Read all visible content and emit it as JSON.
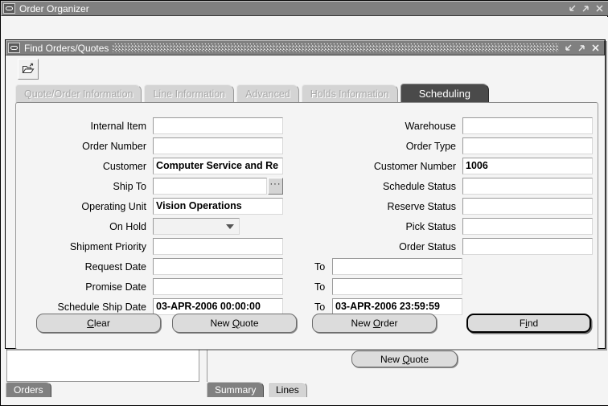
{
  "organizer": {
    "title": "Order Organizer",
    "titlebar_icon": "oracle-window-icon",
    "minimize_icon": "minimize-icon",
    "maximize_icon": "maximize-icon",
    "close_icon": "close-icon"
  },
  "background": {
    "orders_tab": "Orders",
    "summary_tab": "Summary",
    "lines_tab": "Lines",
    "new_quote_label": "New Quote"
  },
  "find_window": {
    "title": "Find  Orders/Quotes",
    "titlebar_icon": "oracle-window-icon",
    "hatch": "window-move-handle",
    "toolbar": {
      "open_folder_label": "open-folder-icon"
    },
    "tabs": [
      {
        "label": "Quote/Order Information",
        "state": "disabled"
      },
      {
        "label": "Line Information",
        "state": "disabled"
      },
      {
        "label": "Advanced",
        "state": "disabled"
      },
      {
        "label": "Holds Information",
        "state": "disabled"
      },
      {
        "label": "Scheduling",
        "state": "active"
      }
    ],
    "left_fields": [
      {
        "label": "Internal Item",
        "value": "",
        "type": "text"
      },
      {
        "label": "Order Number",
        "value": "",
        "type": "text"
      },
      {
        "label": "Customer",
        "value": "Computer Service and Re",
        "type": "text"
      },
      {
        "label": "Ship To",
        "value": "",
        "type": "lov",
        "lov_label": "···"
      },
      {
        "label": "Operating Unit",
        "value": "Vision Operations",
        "type": "text"
      },
      {
        "label": "On Hold",
        "value": "",
        "type": "combo"
      },
      {
        "label": "Shipment Priority",
        "value": "",
        "type": "text"
      },
      {
        "label": "Request Date",
        "value": "",
        "type": "text",
        "to_label": "To",
        "to_value": ""
      },
      {
        "label": "Promise Date",
        "value": "",
        "type": "text",
        "to_label": "To",
        "to_value": ""
      },
      {
        "label": "Schedule Ship Date",
        "value": "03-APR-2006 00:00:00",
        "type": "text",
        "to_label": "To",
        "to_value": "03-APR-2006 23:59:59"
      }
    ],
    "right_fields": [
      {
        "label": "Warehouse",
        "value": ""
      },
      {
        "label": "Order Type",
        "value": ""
      },
      {
        "label": "Customer Number",
        "value": "1006"
      },
      {
        "label": "Schedule Status",
        "value": ""
      },
      {
        "label": "Reserve Status",
        "value": ""
      },
      {
        "label": "Pick Status",
        "value": ""
      },
      {
        "label": "Order Status",
        "value": ""
      }
    ],
    "actions": [
      {
        "label": "Clear",
        "accel": "C",
        "default": false
      },
      {
        "label": "New Quote",
        "accel": "Q",
        "default": false
      },
      {
        "label": "New Order",
        "accel": "O",
        "default": false
      },
      {
        "label": "Find",
        "accel": "i",
        "default": true
      }
    ]
  },
  "colors": {
    "titlebar": "#808080",
    "window_bg": "#f4f4f4",
    "active_tab": "#4a4a4a",
    "disabled_tab": "#d4d4d4",
    "button_face": "#dcdcdc",
    "field_bg": "#ffffff"
  }
}
